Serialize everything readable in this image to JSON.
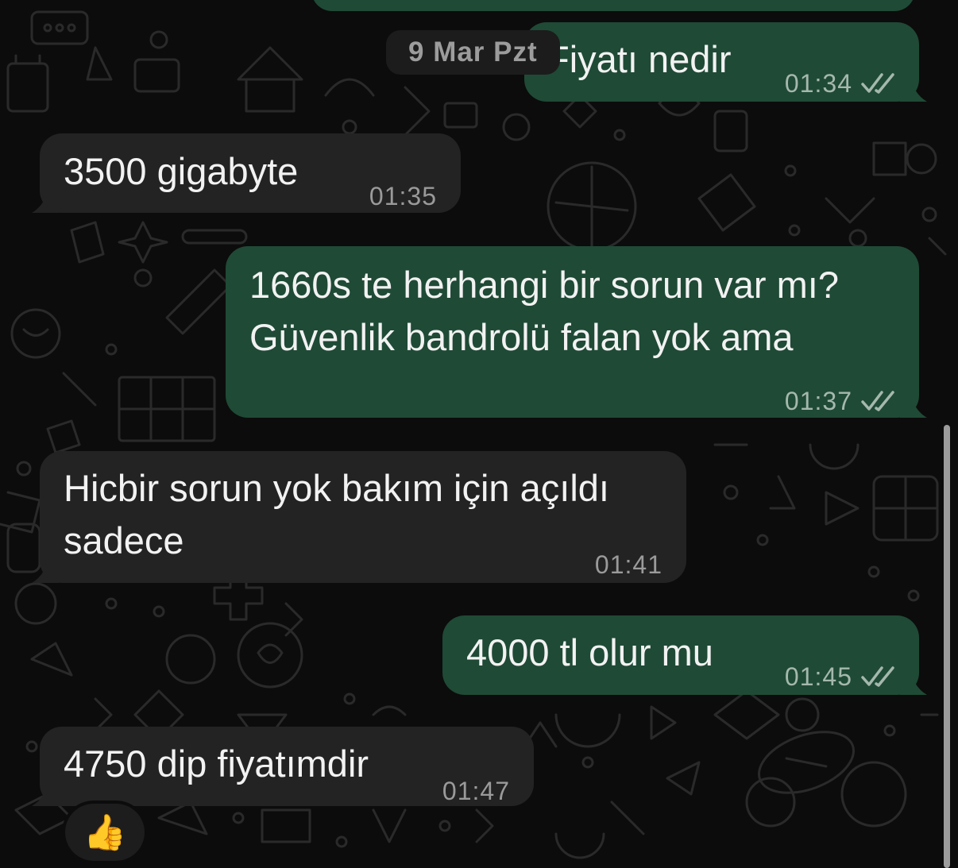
{
  "date_label": "9 Mar Pzt",
  "messages": [
    {
      "direction": "out",
      "lines": [
        "Fiyatı nedir"
      ],
      "time": "01:34",
      "read": true
    },
    {
      "direction": "in",
      "lines": [
        "3500 gigabyte"
      ],
      "time": "01:35"
    },
    {
      "direction": "out",
      "lines": [
        "1660s te herhangi bir sorun var mı?",
        "Güvenlik bandrolü falan yok ama"
      ],
      "time": "01:37",
      "read": true
    },
    {
      "direction": "in",
      "lines": [
        "Hicbir sorun yok bakım için açıldı",
        "sadece"
      ],
      "time": "01:41"
    },
    {
      "direction": "out",
      "lines": [
        "4000 tl olur mu"
      ],
      "time": "01:45",
      "read": true
    },
    {
      "direction": "in",
      "lines": [
        "4750 dip fiyatımdir"
      ],
      "time": "01:47",
      "reaction": "👍"
    }
  ],
  "colors": {
    "background": "#0c0c0c",
    "outgoing_bubble": "#1f4a36",
    "incoming_bubble": "#232323",
    "read_ticks": "#a5b8ad"
  },
  "icons": {
    "read_receipt": "double-check-icon",
    "reaction": "thumbs-up-emoji"
  }
}
